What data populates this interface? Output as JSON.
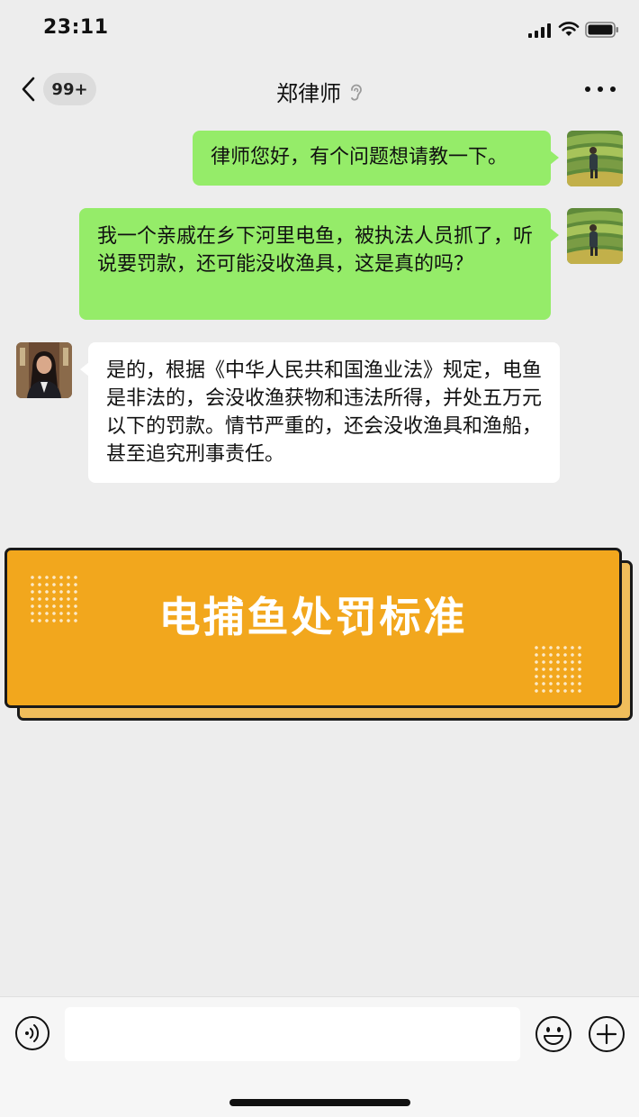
{
  "status_bar": {
    "time": "23:11",
    "icons": [
      "signal-icon",
      "wifi-icon",
      "battery-icon"
    ]
  },
  "nav": {
    "back_icon": "chevron-left-icon",
    "unread_count": "99+",
    "title": "郑律师",
    "title_icon": "ear-icon",
    "more_icon": "more-dots-icon"
  },
  "messages": [
    {
      "direction": "out",
      "sender": "me",
      "text": "律师您好，有个问题想请教一下。"
    },
    {
      "direction": "out",
      "sender": "me",
      "text": "我一个亲戚在乡下河里电鱼，被执法人员抓了，听说要罚款，还可能没收渔具，这是真的吗？"
    },
    {
      "direction": "in",
      "sender": "郑律师",
      "text": "是的，根据《中华人民共和国渔业法》规定，电鱼是非法的，会没收渔获物和违法所得，并处五万元以下的罚款。情节严重的，还会没收渔具和渔船，甚至追究刑事责任。"
    }
  ],
  "banner": {
    "title": "电捕鱼处罚标准"
  },
  "input_bar": {
    "voice_icon": "voice-icon",
    "input_value": "",
    "input_placeholder": "",
    "emoji_icon": "emoji-icon",
    "plus_icon": "plus-icon"
  },
  "colors": {
    "background": "#ededed",
    "outgoing_bubble": "#95ec69",
    "incoming_bubble": "#ffffff",
    "banner_fill": "#f2a71d",
    "banner_shadow": "#f0bd5b",
    "banner_border": "#1a1a1a"
  }
}
